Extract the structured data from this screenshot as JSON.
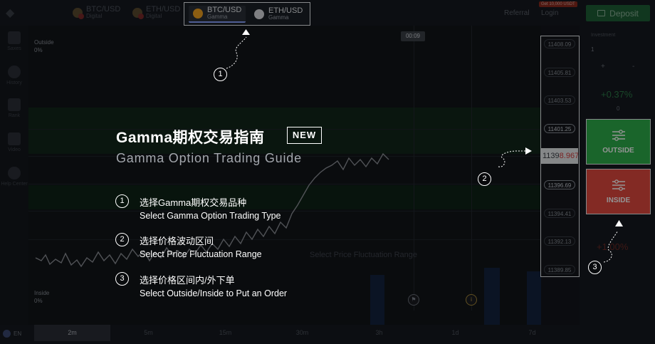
{
  "topbar": {
    "assets": [
      {
        "name": "BTC/USD",
        "type": "Digital"
      },
      {
        "name": "ETH/USD",
        "type": "Digital"
      }
    ],
    "highlighted_assets": [
      {
        "name": "BTC/USD",
        "type": "Gamma",
        "active": true
      },
      {
        "name": "ETH/USD",
        "type": "Gamma",
        "active": false
      }
    ],
    "referral_label": "Referral",
    "login_label": "Login",
    "bonus_badge": "Get 10,000 USDT",
    "deposit_label": "Deposit"
  },
  "leftnav": {
    "items": [
      {
        "label": "Saxes",
        "icon": "bar-chart-icon"
      },
      {
        "label": "History",
        "icon": "history-icon"
      },
      {
        "label": "Rank",
        "icon": "trophy-icon"
      },
      {
        "label": "Video",
        "icon": "video-icon"
      },
      {
        "label": "Help Center",
        "icon": "lightbulb-icon"
      }
    ]
  },
  "chart": {
    "outside_label": "Outside",
    "outside_pct": "0%",
    "inside_label": "Inside",
    "inside_pct": "0%",
    "timer": "00:09",
    "bg_hint": "Select Price Fluctuation Range"
  },
  "price_scale": {
    "upper": [
      "11408.09",
      "11405.81",
      "11403.53",
      "11401.25"
    ],
    "current_prefix": "1139",
    "current_suffix": "8.9678",
    "lower": [
      "11396.69",
      "11394.41",
      "11392.13",
      "11389.85"
    ]
  },
  "right_panel": {
    "investment_label": "Investment",
    "investment_value": "1",
    "plus": "+",
    "minus": "-",
    "outside_profit": "+0.37%",
    "zero": "0",
    "inside_profit": "+1.00%",
    "outside_button": "OUTSIDE",
    "inside_button": "INSIDE"
  },
  "bottombar": {
    "language": "EN",
    "timeframes": [
      "2m",
      "5m",
      "15m",
      "30m",
      "3h",
      "1d",
      "7d"
    ],
    "active_timeframe": "2m"
  },
  "guide": {
    "title_cn": "Gamma期权交易指南",
    "new_badge": "NEW",
    "title_en": "Gamma Option Trading Guide",
    "steps": [
      {
        "num": "1",
        "cn": "选择Gamma期权交易品种",
        "en": "Select Gamma Option Trading Type"
      },
      {
        "num": "2",
        "cn": "选择价格波动区间",
        "en": "Select Price Fluctuation Range"
      },
      {
        "num": "3",
        "cn": "选择价格区间内/外下单",
        "en": "Select Outside/Inside to Put an Order"
      }
    ],
    "callouts": [
      "1",
      "2",
      "3"
    ]
  },
  "colors": {
    "outside_green": "#2eae4a",
    "inside_red": "#e2493f",
    "price_red": "#d23c3c",
    "deposit_green": "#1e5f36"
  }
}
